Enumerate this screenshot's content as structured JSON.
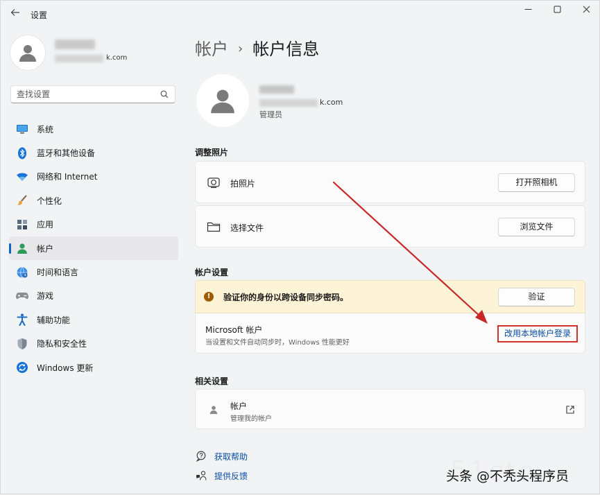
{
  "app": {
    "title": "设置"
  },
  "profile": {
    "email_suffix": "k.com"
  },
  "search": {
    "placeholder": "查找设置"
  },
  "sidebar": {
    "items": [
      {
        "label": "系统",
        "icon": "monitor-icon"
      },
      {
        "label": "蓝牙和其他设备",
        "icon": "bluetooth-icon"
      },
      {
        "label": "网络和 Internet",
        "icon": "wifi-icon"
      },
      {
        "label": "个性化",
        "icon": "brush-icon"
      },
      {
        "label": "应用",
        "icon": "apps-icon"
      },
      {
        "label": "帐户",
        "icon": "person-icon",
        "active": true
      },
      {
        "label": "时间和语言",
        "icon": "globe-clock-icon"
      },
      {
        "label": "游戏",
        "icon": "gamepad-icon"
      },
      {
        "label": "辅助功能",
        "icon": "accessibility-icon"
      },
      {
        "label": "隐私和安全性",
        "icon": "shield-icon"
      },
      {
        "label": "Windows 更新",
        "icon": "sync-icon"
      }
    ]
  },
  "breadcrumb": {
    "parent": "帐户",
    "separator": "›",
    "current": "帐户信息"
  },
  "account": {
    "email_suffix": "k.com",
    "role": "管理员"
  },
  "photo_section": {
    "title": "调整照片",
    "take_photo": {
      "label": "拍照片",
      "button": "打开照相机"
    },
    "choose_file": {
      "label": "选择文件",
      "button": "浏览文件"
    }
  },
  "account_settings": {
    "title": "帐户设置",
    "warning": {
      "text": "验证你的身份以跨设备同步密码。",
      "button": "验证"
    },
    "microsoft": {
      "title": "Microsoft 帐户",
      "description": "当设置和文件自动同步时，Windows 性能更好",
      "link": "改用本地帐户登录"
    }
  },
  "related": {
    "title": "相关设置",
    "accounts": {
      "title": "帐户",
      "description": "管理我的帐户"
    }
  },
  "footer": {
    "help": "获取帮助",
    "feedback": "提供反馈"
  },
  "watermark": {
    "text": "头条 @不秃头程序员",
    "ghost": "51cto"
  },
  "colors": {
    "accent": "#0a64c8",
    "link": "#0a4da2",
    "warning_bg": "#fdf3d6",
    "highlight_box": "#d2312e",
    "annotation_arrow": "#c62828"
  }
}
